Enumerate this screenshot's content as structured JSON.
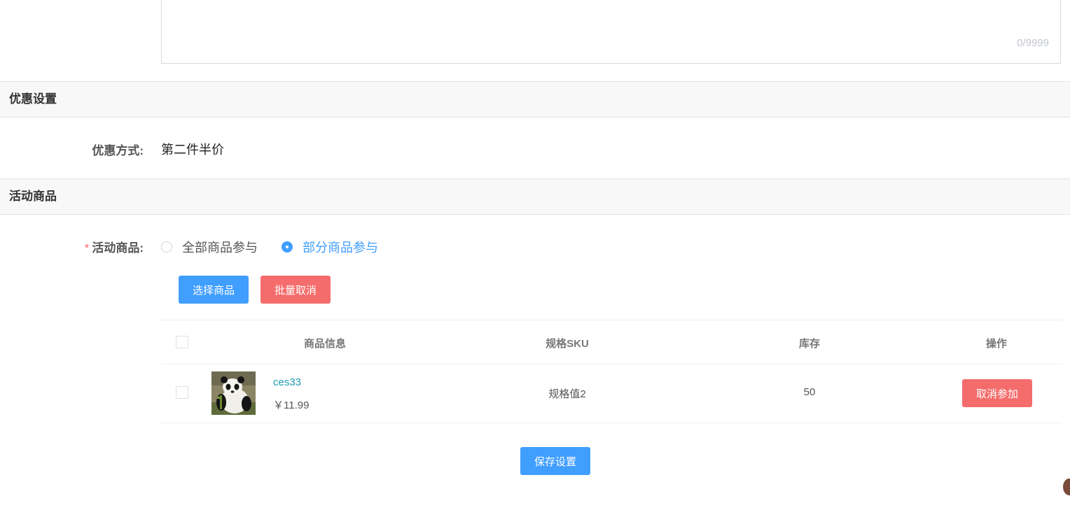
{
  "description": {
    "char_count": "0/9999"
  },
  "discount_section": {
    "title": "优惠设置",
    "method_label": "优惠方式:",
    "method_value": "第二件半价"
  },
  "products_section": {
    "title": "活动商品",
    "required_mark": "*",
    "field_label": "活动商品:",
    "options": [
      {
        "label": "全部商品参与",
        "selected": false
      },
      {
        "label": "部分商品参与",
        "selected": true
      }
    ],
    "select_button": "选择商品",
    "batch_cancel_button": "批量取消"
  },
  "table": {
    "headers": {
      "info": "商品信息",
      "sku": "规格SKU",
      "stock": "库存",
      "action": "操作"
    },
    "rows": [
      {
        "name": "ces33",
        "price": "￥11.99",
        "sku": "规格值2",
        "stock": "50",
        "action": "取消参加",
        "image": "panda-photo"
      }
    ]
  },
  "save_button": "保存设置",
  "colors": {
    "primary": "#409eff",
    "danger": "#f56c6c",
    "link": "#1f9bb0"
  }
}
